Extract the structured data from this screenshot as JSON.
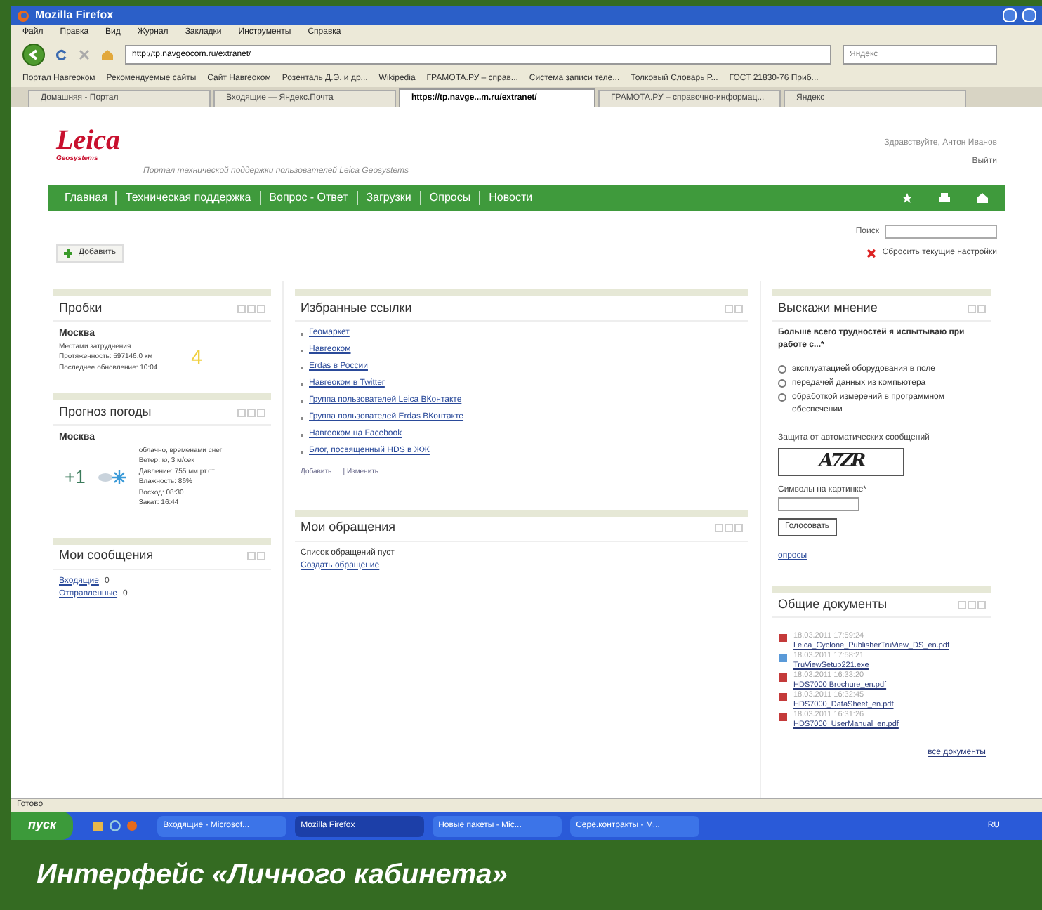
{
  "window": {
    "title": "Mozilla Firefox"
  },
  "menu": [
    "Файл",
    "Правка",
    "Вид",
    "Журнал",
    "Закладки",
    "Инструменты",
    "Справка"
  ],
  "address": {
    "value": "http://tp.navgeocom.ru/extranet/"
  },
  "search": {
    "placeholder": "Яндекс"
  },
  "bookmarks": [
    "Портал Навгеоком",
    "Рекомендуемые сайты",
    "Сайт Навгеоком",
    "Розенталь Д.Э. и др...",
    "Wikipedia",
    "ГРАМОТА.РУ – справ...",
    "Система записи теле...",
    "Толковый Словарь Р...",
    "ГОСТ 21830-76 Приб..."
  ],
  "tabs": [
    {
      "label": "Домашняя - Портал",
      "selected": false
    },
    {
      "label": "Входящие — Яндекс.Почта",
      "selected": false
    },
    {
      "label": "https://tp.navge...m.ru/extranet/",
      "selected": true
    },
    {
      "label": "ГРАМОТА.РУ – справочно-информац...",
      "selected": false
    },
    {
      "label": "Яндекс",
      "selected": false
    }
  ],
  "header": {
    "logo": "Leica",
    "logo_sub": "Geosystems",
    "tagline": "Портал технической поддержки пользователей Leica Geosystems",
    "greeting": "Здравствуйте, Антон Иванов",
    "logout": "Выйти"
  },
  "nav": [
    "Главная",
    "Техническая поддержка",
    "Вопрос - Ответ",
    "Загрузки",
    "Опросы",
    "Новости"
  ],
  "add_button": "Добавить",
  "search_box": {
    "label": "Поиск",
    "reset": "Сбросить текущие настройки"
  },
  "traffic": {
    "title": "Пробки",
    "city": "Москва",
    "lines": [
      "Местами затруднения",
      "Протяженность: 597146.0 км",
      "Последнее обновление: 10:04"
    ],
    "score": "4"
  },
  "weather": {
    "title": "Прогноз погоды",
    "city": "Москва",
    "temp": "+1",
    "lines": [
      "облачно, временами снег",
      "Ветер: ю, 3 м/сек",
      "Давление: 755 мм.рт.ст",
      "Влажность: 86%",
      "Восход: 08:30",
      "Закат: 16:44"
    ]
  },
  "messages": {
    "title": "Мои сообщения",
    "items": [
      {
        "label": "Входящие",
        "count": "0"
      },
      {
        "label": "Отправленные",
        "count": "0"
      }
    ]
  },
  "links": {
    "title": "Избранные ссылки",
    "items": [
      "Геомаркет",
      "Навгеоком",
      "Erdas в России",
      "Навгеоком в Twitter",
      "Группа пользователей Leica ВКонтакте",
      "Группа пользователей Erdas ВКонтакте",
      "Навгеоком на Facebook",
      "Блог, посвященный HDS в ЖЖ"
    ],
    "actions": [
      "Добавить...",
      "| Изменить..."
    ]
  },
  "requests": {
    "title": "Мои обращения",
    "empty": "Список обращений пуст",
    "create": "Создать обращение"
  },
  "poll": {
    "title": "Выскажи мнение",
    "question": "Больше всего трудностей я испытываю при работе с...*",
    "options": [
      {
        "label": "эксплуатацией оборудования в поле",
        "selected": false
      },
      {
        "label": "передачей данных из компьютера",
        "selected": false
      },
      {
        "label": "обработкой измерений в программном обеспечении",
        "selected": false
      }
    ],
    "captcha_label": "Защита от автоматических сообщений",
    "captcha": "A7ZR",
    "input_label": "Символы на картинке*",
    "vote": "Голосовать",
    "more": "опросы"
  },
  "documents": {
    "title": "Общие документы",
    "items": [
      {
        "kind": "pdf",
        "date": "18.03.2011 17:59:24",
        "name": "Leica_Cyclone_PublisherTruView_DS_en.pdf"
      },
      {
        "kind": "exe",
        "date": "18.03.2011 17:58:21",
        "name": "TruViewSetup221.exe"
      },
      {
        "kind": "pdf",
        "date": "18.03.2011 16:33:20",
        "name": "HDS7000 Brochure_en.pdf"
      },
      {
        "kind": "pdf",
        "date": "18.03.2011 16:32:45",
        "name": "HDS7000_DataSheet_en.pdf"
      },
      {
        "kind": "pdf",
        "date": "18.03.2011 16:31:26",
        "name": "HDS7000_UserManual_en.pdf"
      }
    ],
    "all": "все документы"
  },
  "status_bar": "Готово",
  "taskbar": {
    "start": "пуск",
    "items": [
      {
        "label": "Входящие - Microsof...",
        "selected": false
      },
      {
        "label": "Mozilla Firefox",
        "selected": true
      },
      {
        "label": "Новые пакеты - Mic...",
        "selected": false
      },
      {
        "label": "Сере.контракты - M...",
        "selected": false
      }
    ],
    "lang": "RU"
  },
  "caption": "Интерфейс «Личного кабинета»"
}
